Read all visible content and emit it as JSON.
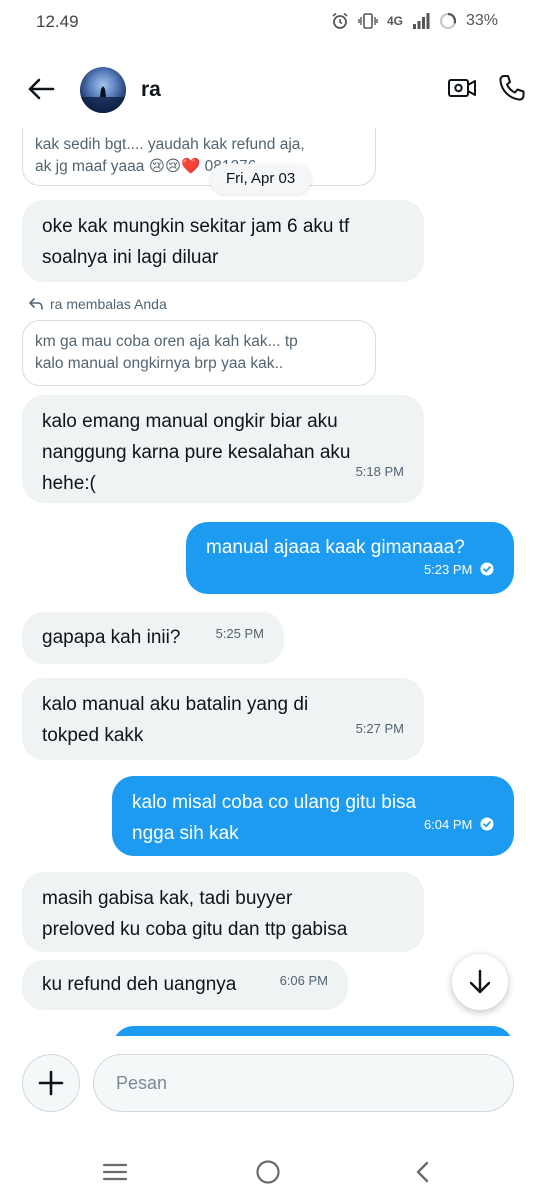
{
  "status_bar": {
    "time": "12.49",
    "network": "4G",
    "battery": "33%"
  },
  "header": {
    "contact_name": "ra"
  },
  "chat": {
    "top_reply": {
      "line1": "kak sedih bgt.... yaudah kak refund aja,",
      "line2": "ak jg maaf yaaa 😢😢❤️ 081276..."
    },
    "date_separator": "Fri, Apr 03",
    "messages": [
      {
        "text_line1": "oke kak mungkin sekitar jam 6 aku tf",
        "text_line2": "soalnya ini lagi diluar"
      },
      {
        "reply_label": "ra membalas Anda",
        "quoted_line1": "km ga mau coba oren aja kah kak... tp",
        "quoted_line2": "kalo manual ongkirnya brp yaa kak.."
      },
      {
        "text_line1": "kalo emang manual ongkir biar aku",
        "text_line2": "nanggung karna pure kesalahan aku",
        "text_line3": "hehe:(",
        "time": "5:18 PM"
      },
      {
        "text": "manual ajaaa kaak gimanaaa?",
        "time": "5:23 PM"
      },
      {
        "text": "gapapa kah inii?",
        "time": "5:25 PM"
      },
      {
        "text_line1": "kalo manual aku batalin yang di",
        "text_line2": "tokped kakk",
        "time": "5:27 PM"
      },
      {
        "text_line1": "kalo misal coba co ulang gitu bisa",
        "text_line2": "ngga sih kak",
        "time": "6:04 PM"
      },
      {
        "text_line1": "masih gabisa kak, tadi buyyer",
        "text_line2": "preloved ku coba gitu dan ttp gabisa"
      },
      {
        "text": "ku refund deh uangnya",
        "time": "6:06 PM"
      }
    ]
  },
  "composer": {
    "placeholder": "Pesan"
  },
  "colors": {
    "accent": "#1d9bf0",
    "incoming_bubble": "#eff3f4",
    "text": "#0f1419",
    "secondary_text": "#536471"
  },
  "icons": {
    "back": "arrow-left-icon",
    "video": "video-camera-icon",
    "call": "phone-icon",
    "add": "plus-icon",
    "scroll": "arrow-down-icon",
    "reply": "reply-arrow-icon",
    "sent": "check-circle-icon"
  }
}
